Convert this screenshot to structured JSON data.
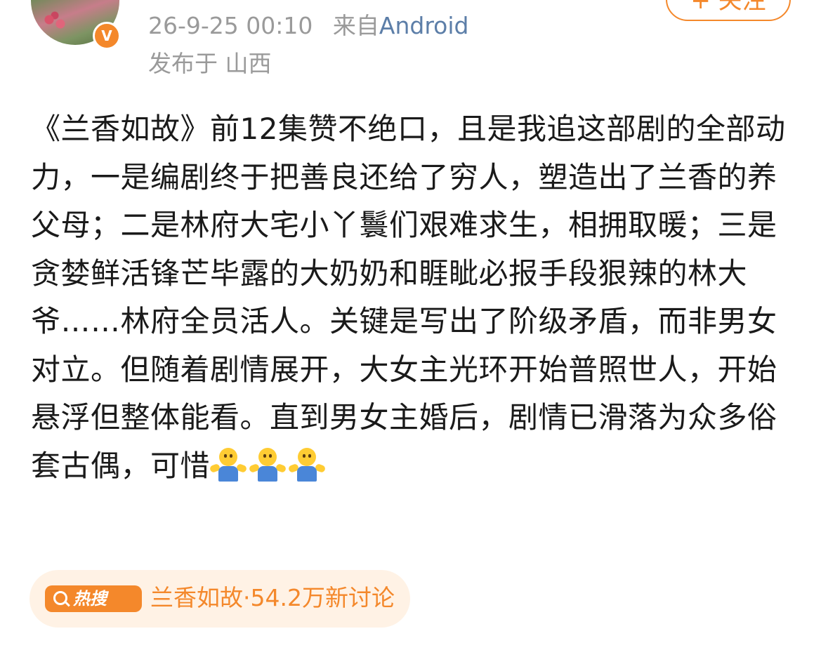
{
  "header": {
    "timestamp": "26-9-25 00:10",
    "source_prefix": "来自",
    "source_device": "Android",
    "location": "发布于 山西",
    "follow_label": "+ 关注",
    "verified_icon": "v-verified-icon"
  },
  "post": {
    "text": "《兰香如故》前12集赞不绝口，且是我追这部剧的全部动力，一是编剧终于把善良还给了穷人，塑造出了兰香的养父母；二是林府大宅小丫鬟们艰难求生，相拥取暖；三是贪婪鲜活锋芒毕露的大奶奶和睚眦必报手段狠辣的林大爷……林府全员活人。关键是写出了阶级矛盾，而非男女对立。但随着剧情展开，大女主光环开始普照世人，开始悬浮但整体能看。直到男女主婚后，剧情已滑落为众多俗套古偶，可惜",
    "emojis": [
      "shrug-emoji",
      "shrug-emoji",
      "shrug-emoji"
    ]
  },
  "hot_search": {
    "badge": "热搜",
    "badge_icon": "search-icon",
    "text": "兰香如故·54.2万新讨论"
  },
  "colors": {
    "accent": "#f4882b",
    "source_link": "#5c7ea8",
    "meta_gray": "#9a9a9a",
    "pill_bg": "#fff2e5"
  }
}
